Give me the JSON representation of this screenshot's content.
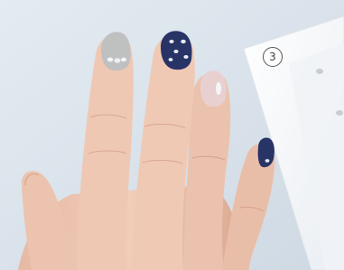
{
  "photo": {
    "step_number": "3",
    "colors": {
      "background": "#dde6ee",
      "skin": "#ecc7b3",
      "skin_shadow": "#d9a993",
      "nail_gray": "#bdbfbf",
      "nail_navy": "#293466",
      "nail_pink": "#e7cfcf",
      "stud_silver": "#f2f3f6",
      "card": "#f7f8fa"
    }
  }
}
